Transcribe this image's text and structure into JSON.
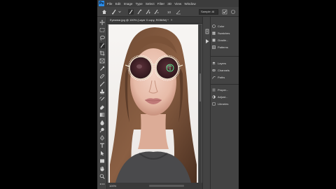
{
  "menu": {
    "logo": "Ps",
    "items": [
      "File",
      "Edit",
      "Image",
      "Type",
      "Select",
      "Filter",
      "3D",
      "View",
      "Window"
    ]
  },
  "options": {
    "sample_text": "Sample: Al",
    "value_hint": "10"
  },
  "document": {
    "tab_title": "Eyewear.jpg @ 100% (Layer 0 copy, RGB/8#) *",
    "close": "×"
  },
  "status": {
    "zoom": "100%"
  },
  "panels": {
    "group1": [
      "Color",
      "Swatches",
      "Gradie...",
      "Patterns"
    ],
    "group2": [
      "Layers",
      "Channels",
      "Paths"
    ],
    "group3": [
      "Proper...",
      "Adjust...",
      "Libraries"
    ]
  },
  "colors": {
    "accent": "#2a8ce8",
    "ui_dark": "#434343",
    "workspace": "#535353"
  },
  "icons": {
    "toolbar": [
      "move-icon",
      "marquee-icon",
      "lasso-icon",
      "quick-select-icon",
      "crop-icon",
      "frame-icon",
      "eyedropper-icon",
      "healing-icon",
      "brush-icon",
      "stamp-icon",
      "history-brush-icon",
      "eraser-icon",
      "gradient-icon",
      "blur-icon",
      "dodge-icon",
      "pen-icon",
      "type-icon",
      "path-select-icon",
      "shape-icon",
      "hand-icon",
      "zoom-icon"
    ]
  }
}
